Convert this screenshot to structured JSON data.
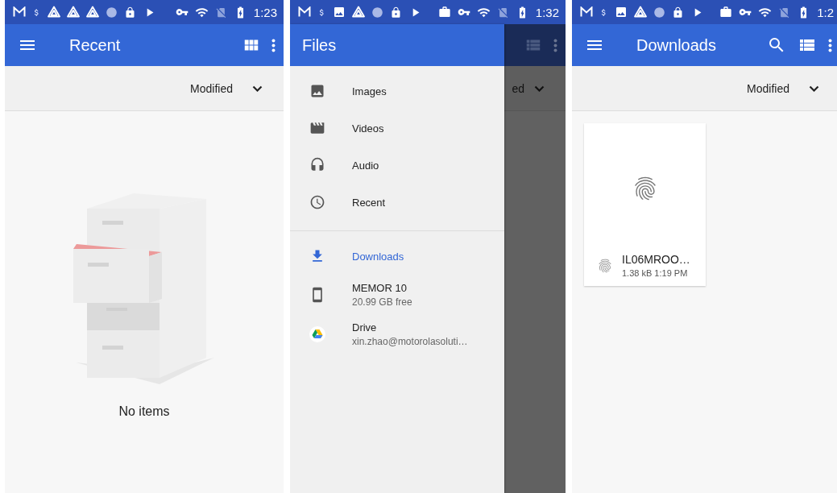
{
  "recent_screen": {
    "status_time": "1:23",
    "title": "Recent",
    "sort_label": "Modified",
    "empty_message": "No items"
  },
  "files_screen": {
    "status_time": "1:32",
    "drawer_title": "Files",
    "background_sort_label": "ed",
    "roots": [
      {
        "kind": "images",
        "label": "Images",
        "selected": false
      },
      {
        "kind": "videos",
        "label": "Videos",
        "selected": false
      },
      {
        "kind": "audio",
        "label": "Audio",
        "selected": false
      },
      {
        "kind": "recent",
        "label": "Recent",
        "selected": false
      }
    ],
    "storage": [
      {
        "kind": "downloads",
        "label": "Downloads",
        "selected": true
      },
      {
        "kind": "device",
        "label": "MEMOR 10",
        "summary": "20.99 GB free",
        "selected": false
      },
      {
        "kind": "drive",
        "label": "Drive",
        "summary": "xin.zhao@motorolasoluti…",
        "selected": false
      }
    ]
  },
  "downloads_screen": {
    "status_time": "1:2",
    "title": "Downloads",
    "sort_label": "Modified",
    "files": [
      {
        "name": "IL06MROO…",
        "meta": "1.38 kB 1:19 PM"
      }
    ]
  }
}
